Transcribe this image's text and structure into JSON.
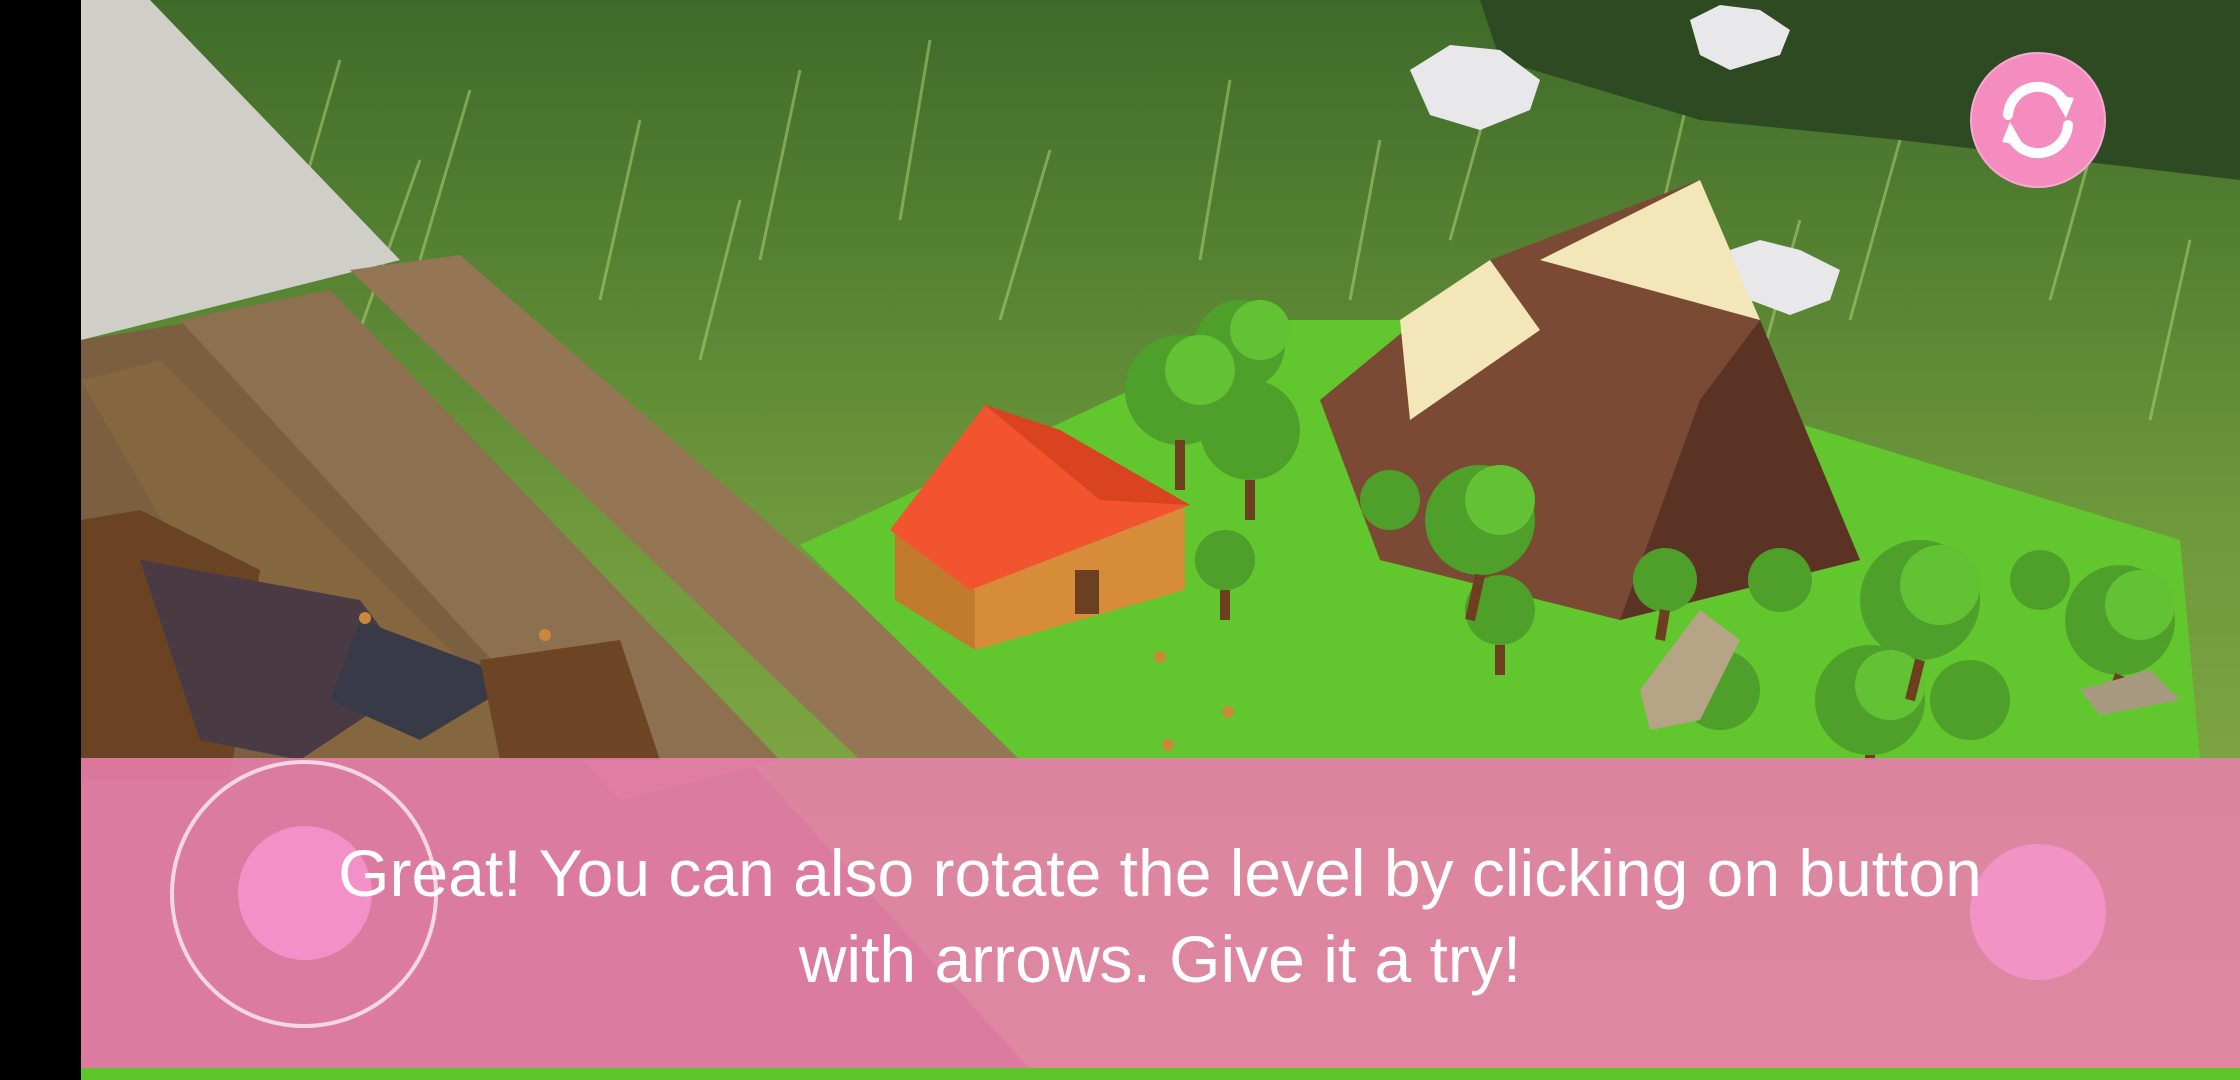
{
  "tutorial": {
    "line1": "Great! You can also rotate the level by clicking on button",
    "line2": "with arrows. Give it a try!"
  },
  "controls": {
    "rotate_button_icon": "rotate-arrows-icon",
    "joystick": "virtual-joystick",
    "action_button": "action-button"
  },
  "colors": {
    "overlay": "#ec80b0",
    "button": "#f48cc0",
    "text": "#ffffff"
  }
}
